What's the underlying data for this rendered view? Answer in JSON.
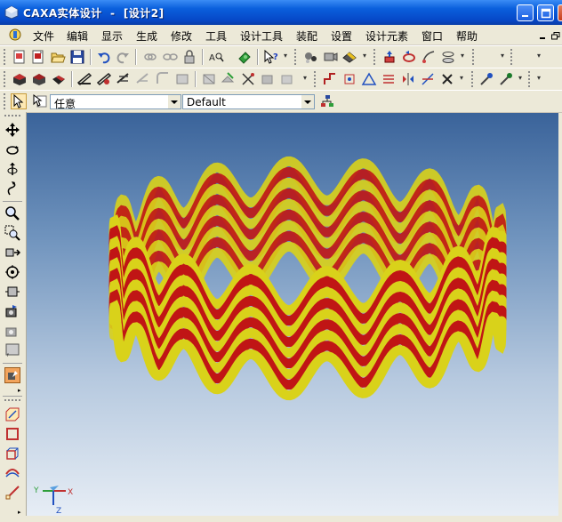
{
  "window": {
    "title": "CAXA实体设计  -  [设计2]",
    "title_bar_color": "#0a5fdc"
  },
  "menubar": {
    "items": [
      "文件",
      "编辑",
      "显示",
      "生成",
      "修改",
      "工具",
      "设计工具",
      "装配",
      "设置",
      "设计元素",
      "窗口",
      "帮助"
    ]
  },
  "property_bar": {
    "filter_value": "任意",
    "style_value": "Default"
  },
  "toolbar_icons": {
    "row1": [
      "new-icon",
      "open-design-icon",
      "open-folder-icon",
      "save-icon",
      "undo-icon",
      "redo-icon",
      "link-icon",
      "unlink-icon",
      "lock-icon",
      "text-search-icon",
      "bookmark-icon",
      "help-cursor-icon",
      "light-icon",
      "camera-icon",
      "render-icon",
      "extrude-icon",
      "revolve-icon",
      "sweep-icon",
      "loft-icon"
    ],
    "row2": [
      "box-icon",
      "cylinder-icon",
      "cone-icon",
      "wedge-icon",
      "sphere-icon",
      "torus-icon",
      "shell-icon",
      "fillet-icon",
      "chamfer-icon",
      "draft-icon",
      "split-icon",
      "section-icon",
      "move-icon",
      "align-icon",
      "pick-icon",
      "eyedropper-icon"
    ]
  },
  "side_tools": [
    "pan-icon",
    "rotate-icon",
    "orbit-icon",
    "walk-icon",
    "zoom-icon",
    "zoom-window-icon",
    "view-dir-icon",
    "focus-icon",
    "fit-icon",
    "camera-view-icon",
    "perspective-icon",
    "shade-icon",
    "sketch-icon",
    "rect-icon",
    "3d-box-icon",
    "curve-icon",
    "line-icon"
  ],
  "colors": {
    "stripe_red": "#c01515",
    "stripe_yellow": "#d9d21a",
    "viewport_top": "#3a639a",
    "viewport_bottom": "#e9eff6"
  },
  "axes": {
    "x_label": "X",
    "y_label": "Y",
    "z_label": "Z"
  }
}
